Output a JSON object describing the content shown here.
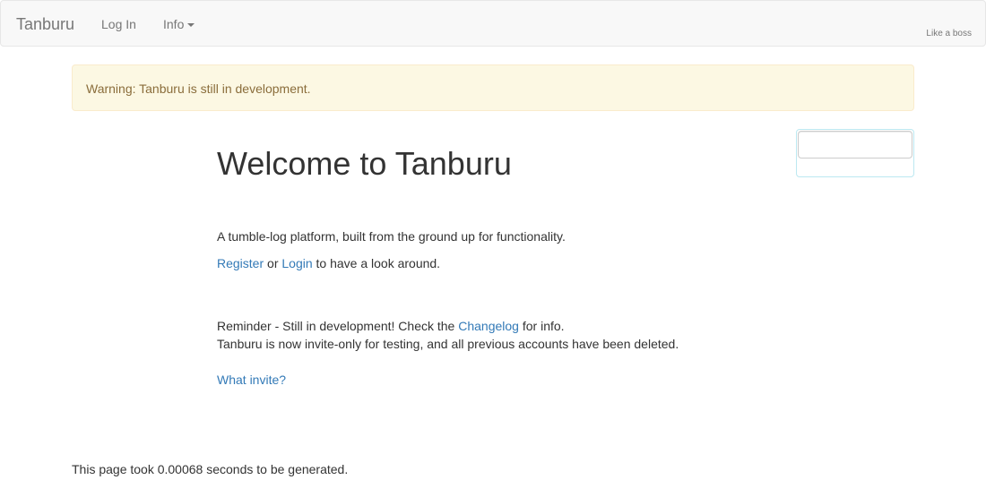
{
  "navbar": {
    "brand": "Tanburu",
    "login_label": "Log In",
    "info_label": "Info",
    "tagline": "Like a boss"
  },
  "alert": {
    "text": "Warning: Tanburu is still in development."
  },
  "main": {
    "title": "Welcome to Tanburu",
    "description": "A tumble-log platform, built from the ground up for functionality.",
    "register_link": "Register",
    "or_text": " or ",
    "login_link": "Login",
    "look_around_text": " to have a look around.",
    "reminder_prefix": "Reminder - Still in development! Check the ",
    "changelog_link": "Changelog",
    "reminder_suffix": " for info.",
    "invite_only_text": "Tanburu is now invite-only for testing, and all previous accounts have been deleted.",
    "what_invite_link": "What invite?"
  },
  "footer": {
    "text": "This page took 0.00068 seconds to be generated."
  },
  "colors": {
    "link": "#337ab7",
    "navbar_bg": "#f8f8f8",
    "alert_bg": "#fcf8e3",
    "alert_text": "#8a6d3b"
  }
}
